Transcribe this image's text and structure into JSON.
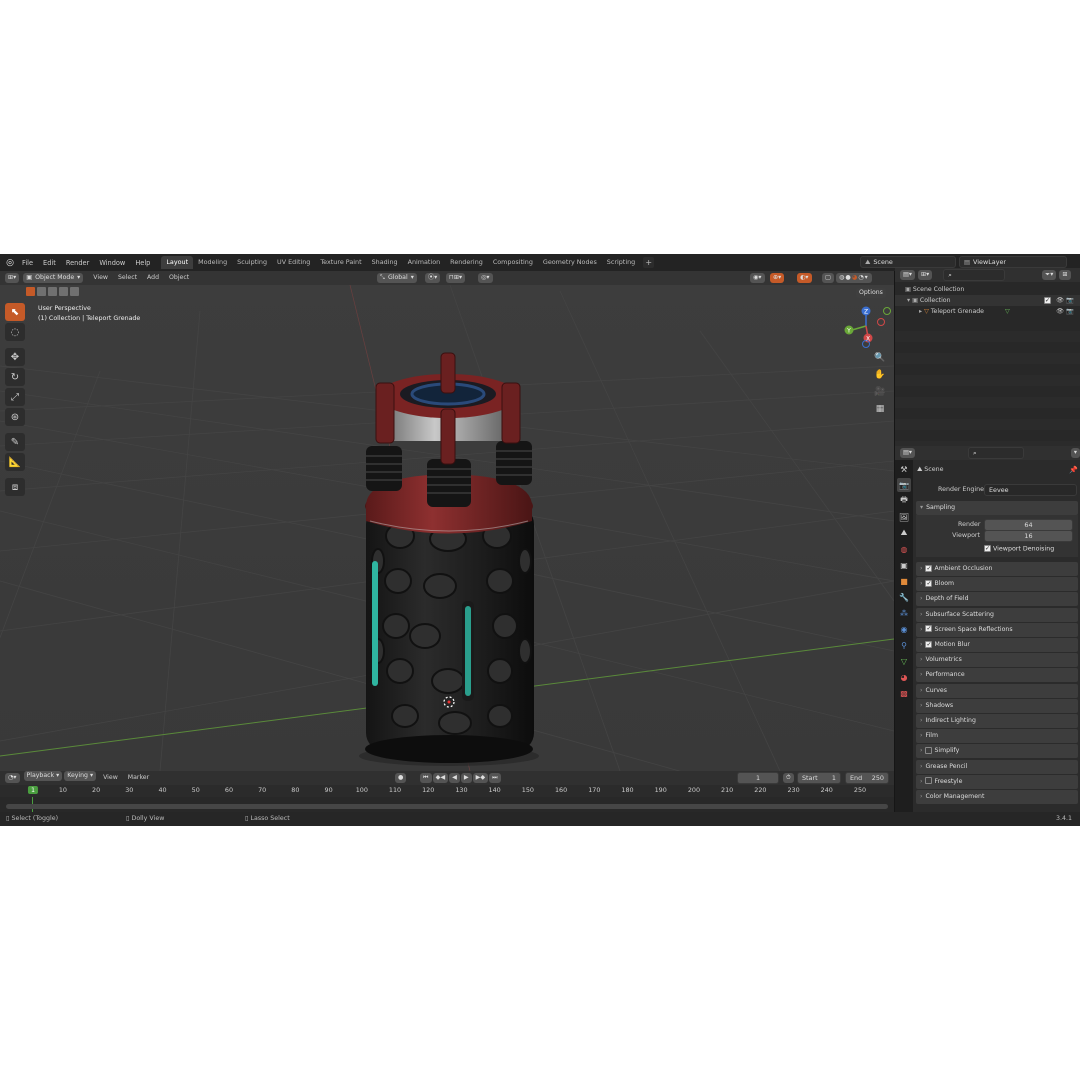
{
  "menu": [
    "File",
    "Edit",
    "Render",
    "Window",
    "Help"
  ],
  "workspaces": [
    "Layout",
    "Modeling",
    "Sculpting",
    "UV Editing",
    "Texture Paint",
    "Shading",
    "Animation",
    "Rendering",
    "Compositing",
    "Geometry Nodes",
    "Scripting"
  ],
  "active_workspace": "Layout",
  "add_workspace": "+",
  "scene_name": "Scene",
  "view_layer": "ViewLayer",
  "viewport": {
    "mode": "Object Mode",
    "menus": [
      "View",
      "Select",
      "Add",
      "Object"
    ],
    "orientation": "Global",
    "options_label": "Options",
    "perspective": "User Perspective",
    "collection_info": "(1) Collection | Teleport Grenade",
    "gizmo": {
      "z": "Z",
      "y": "Y",
      "x": "X"
    }
  },
  "outliner": {
    "root": "Scene Collection",
    "collection": "Collection",
    "object": "Teleport Grenade"
  },
  "properties": {
    "context": "Scene",
    "render_engine_label": "Render Engine",
    "render_engine": "Eevee",
    "sampling_label": "Sampling",
    "render_label": "Render",
    "render_samples": "64",
    "viewport_label": "Viewport",
    "viewport_samples": "16",
    "viewport_denoising": "Viewport Denoising",
    "panels": [
      {
        "label": "Ambient Occlusion",
        "checkbox": true
      },
      {
        "label": "Bloom",
        "checkbox": true
      },
      {
        "label": "Depth of Field",
        "checkbox": null
      },
      {
        "label": "Subsurface Scattering",
        "checkbox": null
      },
      {
        "label": "Screen Space Reflections",
        "checkbox": true
      },
      {
        "label": "Motion Blur",
        "checkbox": true
      },
      {
        "label": "Volumetrics",
        "checkbox": null
      },
      {
        "label": "Performance",
        "checkbox": null
      },
      {
        "label": "Curves",
        "checkbox": null
      },
      {
        "label": "Shadows",
        "checkbox": null
      },
      {
        "label": "Indirect Lighting",
        "checkbox": null
      },
      {
        "label": "Film",
        "checkbox": null
      },
      {
        "label": "Simplify",
        "checkbox": false
      },
      {
        "label": "Grease Pencil",
        "checkbox": null
      },
      {
        "label": "Freestyle",
        "checkbox": false
      },
      {
        "label": "Color Management",
        "checkbox": null
      }
    ]
  },
  "timeline": {
    "menus": [
      "Playback",
      "Keying",
      "View",
      "Marker"
    ],
    "current_frame": "1",
    "start_label": "Start",
    "start": "1",
    "end_label": "End",
    "end": "250",
    "ruler": [
      "1",
      "10",
      "20",
      "30",
      "40",
      "50",
      "60",
      "70",
      "80",
      "90",
      "100",
      "110",
      "120",
      "130",
      "140",
      "150",
      "160",
      "170",
      "180",
      "190",
      "200",
      "210",
      "220",
      "230",
      "240",
      "250"
    ]
  },
  "status": {
    "select": "Select (Toggle)",
    "dolly": "Dolly View",
    "lasso": "Lasso Select",
    "version": "3.4.1"
  },
  "colors": {
    "accent": "#c55a28",
    "active_frame": "#4a9e3f",
    "teal": "#2fb5a0",
    "red_body": "#8a2b2b"
  }
}
